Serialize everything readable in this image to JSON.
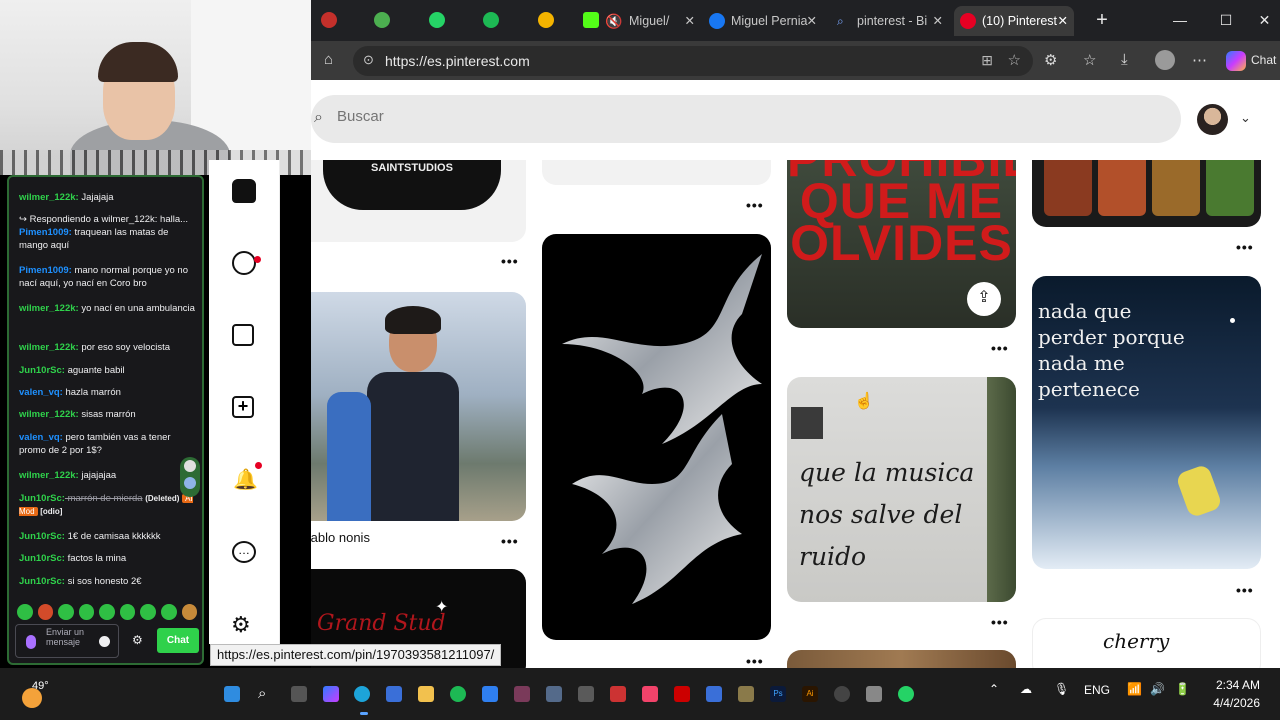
{
  "chat": {
    "messages": [
      {
        "user": "wilmer_122k:",
        "text": " Jajajaja",
        "color": "#2fd14b"
      },
      {
        "reply": "Respondiendo a wilmer_122k: halla..."
      },
      {
        "user": "Pimen1009:",
        "text": " traquean las matas de mango aquí",
        "color": "#1e90ff"
      },
      {
        "user": "Pimen1009:",
        "text": " mano normal porque yo no nací aquí, yo nací en Coro bro",
        "color": "#1e90ff"
      },
      {
        "user": "wilmer_122k:",
        "text": " yo nací en una ambulancia",
        "color": "#2fd14b"
      },
      {
        "user": "wilmer_122k:",
        "text": " por eso soy velocista",
        "color": "#2fd14b"
      },
      {
        "user": "Jun10rSc:",
        "text": " aguante babil",
        "color": "#2fd14b"
      },
      {
        "user": "valen_vq:",
        "text": " hazla marrón",
        "color": "#1e90ff"
      },
      {
        "user": "wilmer_122k:",
        "text": " sisas marrón",
        "color": "#2fd14b"
      },
      {
        "user": "valen_vq:",
        "text": " pero también vas a tener promo de 2 por 1$?",
        "color": "#1e90ff"
      },
      {
        "user": "wilmer_122k:",
        "text": " jajajajaa",
        "color": "#2fd14b"
      },
      {
        "user": "Jun10rSc:",
        "text": " marrón de mierda",
        "deleted": "(Deleted)",
        "badge": "AI Mod",
        "tag": "[odio]",
        "color": "#2fd14b"
      },
      {
        "user": "Jun10rSc:",
        "text": " 1€ de camisaa kkkkkk",
        "color": "#2fd14b"
      },
      {
        "user": "Jun10rSc:",
        "text": " factos la mina",
        "color": "#2fd14b"
      },
      {
        "user": "Jun10rSc:",
        "text": " si sos honesto 2€",
        "color": "#2fd14b"
      }
    ],
    "input_placeholder": "Enviar un mensaje",
    "send_label": "Chat"
  },
  "browser": {
    "tabs": [
      {
        "label": "Miguel/",
        "icon": "speaker-muted-icon"
      },
      {
        "label": "Miguel Pernia",
        "icon": "facebook-icon"
      },
      {
        "label": "pinterest - Bi",
        "icon": "search-icon"
      },
      {
        "label": "(10) Pinterest",
        "icon": "pinterest-icon",
        "active": true
      }
    ],
    "url": "https://es.pinterest.com",
    "copilot_label": "Chat"
  },
  "page": {
    "search_placeholder": "Buscar",
    "pins": [
      {
        "title": "Pablo nonis"
      }
    ],
    "graffiti_text": "que la musica nos salve del ruido",
    "poster_text": "PROHIBIDO QUE ME OLVIDES",
    "snow_text": "nada que perder porque nada me pertenece",
    "stud_text": "Grand Stud",
    "cherry_text": "cherry",
    "sweater_text": "SAINTSTUDIOS"
  },
  "status_url": "https://es.pinterest.com/pin/1970393581211097/",
  "taskbar": {
    "weather_temp": "49°",
    "language": "ENG",
    "time": "2:34 AM",
    "date": "4/4/2026"
  },
  "colors": {
    "pinterest_red": "#e60023",
    "chat_green": "#2fd14b",
    "chat_bg": "#18181b"
  }
}
